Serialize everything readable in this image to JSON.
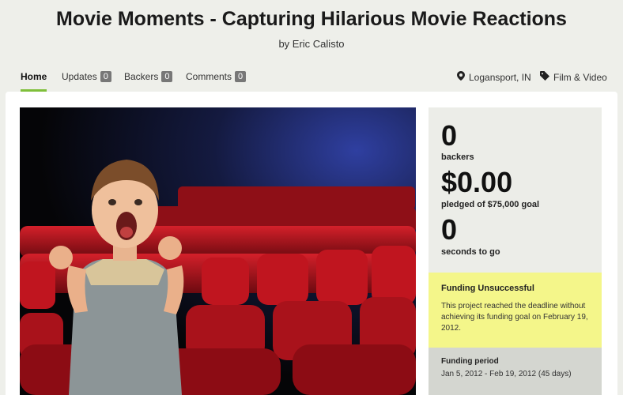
{
  "project": {
    "title": "Movie Moments - Capturing Hilarious Movie Reactions",
    "byline": "by Eric Calisto"
  },
  "nav": {
    "home": "Home",
    "updates": {
      "label": "Updates",
      "count": "0"
    },
    "backers": {
      "label": "Backers",
      "count": "0"
    },
    "comments": {
      "label": "Comments",
      "count": "0"
    },
    "location": "Logansport, IN",
    "category": "Film & Video"
  },
  "stats": {
    "backers_value": "0",
    "backers_label": "backers",
    "pledged_value": "$0.00",
    "pledged_label": "pledged of $75,000 goal",
    "time_value": "0",
    "time_label": "seconds to go"
  },
  "status": {
    "heading": "Funding Unsuccessful",
    "message": "This project reached the deadline without achieving its funding goal on February 19, 2012."
  },
  "funding_period": {
    "heading": "Funding period",
    "range": "Jan 5, 2012 - Feb 19, 2012 (45 days)"
  },
  "colors": {
    "accent": "#7fbf3a",
    "status_bg": "#f4f68a",
    "seat_red": "#b3121b"
  },
  "icons": {
    "location": "map-pin-icon",
    "category": "tag-icon"
  }
}
